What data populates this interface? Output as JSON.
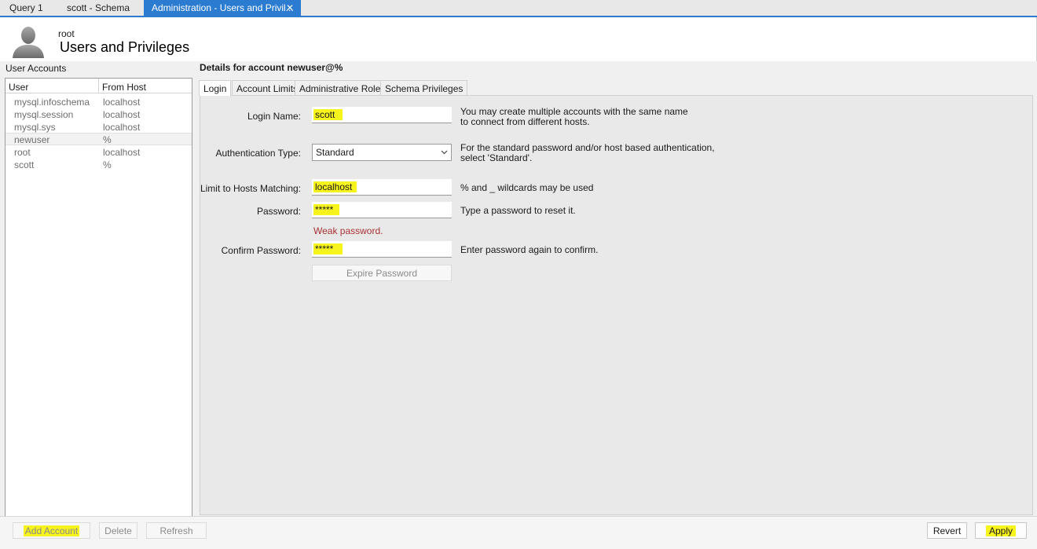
{
  "tabs": [
    {
      "label": "Query 1"
    },
    {
      "label": "scott - Schema"
    },
    {
      "label": "Administration - Users and Privil..."
    }
  ],
  "header": {
    "user": "root",
    "title": "Users and Privileges"
  },
  "left": {
    "section_label": "User Accounts",
    "columns": [
      "User",
      "From Host"
    ],
    "rows": [
      {
        "user": "mysql.infoschema",
        "host": "localhost"
      },
      {
        "user": "mysql.session",
        "host": "localhost"
      },
      {
        "user": "mysql.sys",
        "host": "localhost"
      },
      {
        "user": "newuser",
        "host": "%"
      },
      {
        "user": "root",
        "host": "localhost"
      },
      {
        "user": "scott",
        "host": "%"
      }
    ],
    "selected_index": 3
  },
  "details": {
    "title": "Details for account newuser@%",
    "tabs": [
      "Login",
      "Account Limits",
      "Administrative Roles",
      "Schema Privileges"
    ],
    "active_tab": "Login",
    "fields": {
      "login_name": {
        "label": "Login Name:",
        "value": "scott",
        "help_1": "You may create multiple accounts with the same name",
        "help_2": "to connect from different hosts."
      },
      "auth_type": {
        "label": "Authentication Type:",
        "value": "Standard",
        "help_1": "For the standard password and/or host based authentication,",
        "help_2": "select 'Standard'."
      },
      "hosts": {
        "label": "Limit to Hosts Matching:",
        "value": "localhost",
        "help": "% and _ wildcards may be used"
      },
      "password": {
        "label": "Password:",
        "value": "*****",
        "help": "Type a password to reset it."
      },
      "weak": "Weak password.",
      "confirm": {
        "label": "Confirm Password:",
        "value": "*****",
        "help": "Enter password again to confirm."
      },
      "expire_button": "Expire Password"
    }
  },
  "bottom": {
    "add": "Add Account",
    "delete": "Delete",
    "refresh": "Refresh",
    "revert": "Revert",
    "apply": "Apply"
  }
}
